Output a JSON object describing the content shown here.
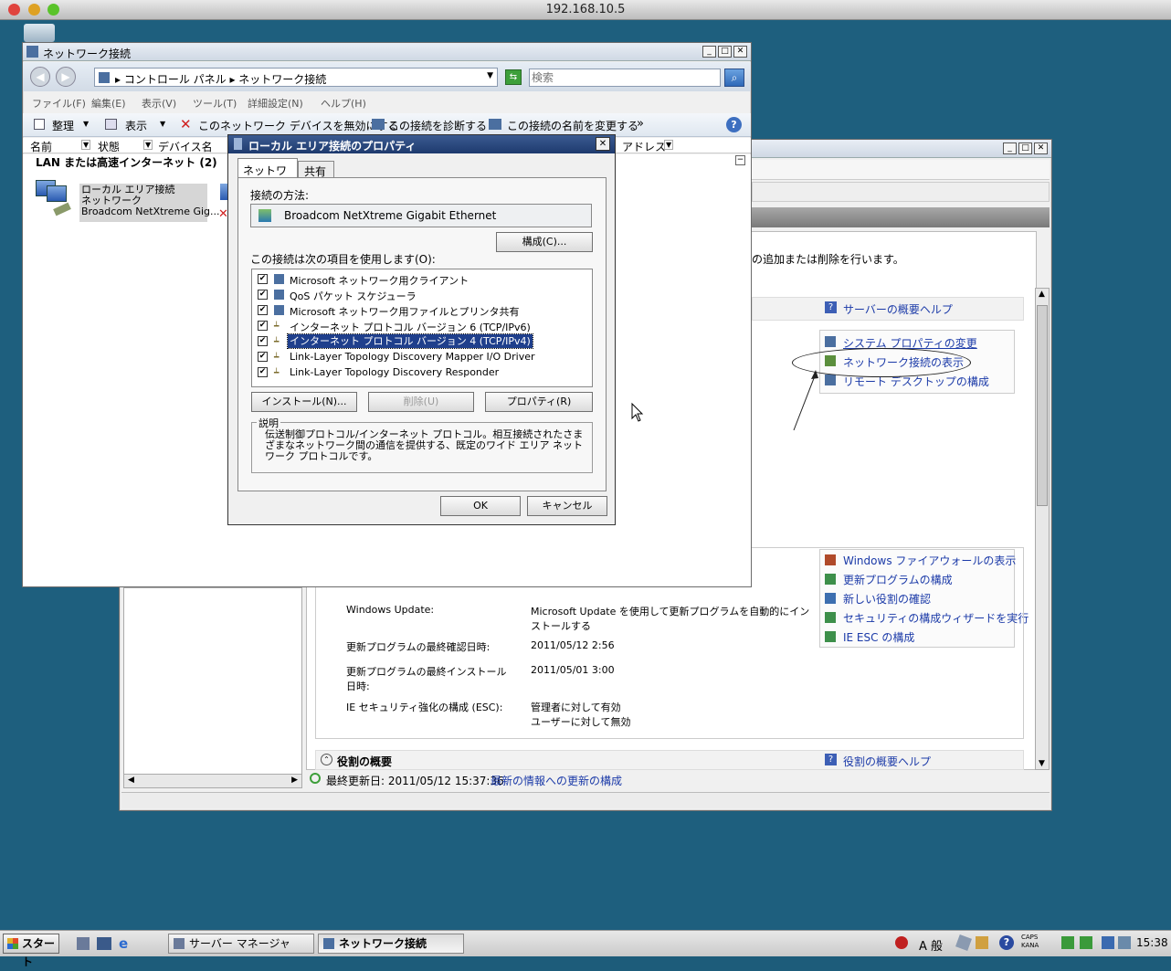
{
  "mac": {
    "title": "192.168.10.5"
  },
  "net_window": {
    "title": "ネットワーク接続",
    "breadcrumb": "▸ コントロール パネル ▸ ネットワーク接続",
    "search_placeholder": "検索",
    "menu": [
      "ファイル(F)",
      "編集(E)",
      "表示(V)",
      "ツール(T)",
      "詳細設定(N)",
      "ヘルプ(H)"
    ],
    "toolbar": {
      "organize": "整理",
      "view": "表示",
      "disable": "このネットワーク デバイスを無効にする",
      "diagnose": "この接続を診断する",
      "rename": "この接続の名前を変更する",
      "more": "»"
    },
    "columns": [
      "名前",
      "状態",
      "デバイス名",
      "アドレス"
    ],
    "group_header": "LAN または高速インターネット (2)",
    "item": {
      "name": "ローカル エリア接続",
      "type": "ネットワーク",
      "device": "Broadcom NetXtreme Gig..."
    }
  },
  "server_manager": {
    "desc_fragment": "の追加または削除を行います。",
    "help_link": "サーバーの概要ヘルプ",
    "links1": [
      "システム プロパティの変更",
      "ネットワーク接続の表示",
      "リモート デスクトップの構成"
    ],
    "links2": [
      "Windows ファイアウォールの表示",
      "更新プログラムの構成",
      "新しい役割の確認",
      "セキュリティの構成ウィザードを実行",
      "IE ESC の構成"
    ],
    "rows": [
      {
        "label": "Windows Update:",
        "value": "Microsoft Update を使用して更新プログラムを自動的にインストールする"
      },
      {
        "label": "更新プログラムの最終確認日時:",
        "value": "2011/05/12 2:56"
      },
      {
        "label": "更新プログラムの最終インストール日時:",
        "value": "2011/05/01 3:00"
      },
      {
        "label": "IE セキュリティ強化の構成 (ESC):",
        "value": "管理者に対して有効\nユーザーに対して無効"
      }
    ],
    "roles_header": "役割の概要",
    "roles_help": "役割の概要ヘルプ",
    "status_updated": "最終更新日: 2011/05/12 15:37:36",
    "status_link": "最新の情報への更新の構成"
  },
  "dialog": {
    "title": "ローカル エリア接続のプロパティ",
    "tabs": [
      "ネットワーク",
      "共有"
    ],
    "connect_using_label": "接続の方法:",
    "adapter": "Broadcom NetXtreme Gigabit Ethernet",
    "configure_btn": "構成(C)...",
    "items_label": "この接続は次の項目を使用します(O):",
    "items": [
      "Microsoft ネットワーク用クライアント",
      "QoS パケット スケジューラ",
      "Microsoft ネットワーク用ファイルとプリンタ共有",
      "インターネット プロトコル バージョン 6 (TCP/IPv6)",
      "インターネット プロトコル バージョン 4 (TCP/IPv4)",
      "Link-Layer Topology Discovery Mapper I/O Driver",
      "Link-Layer Topology Discovery Responder"
    ],
    "install_btn": "インストール(N)...",
    "uninstall_btn": "削除(U)",
    "properties_btn": "プロパティ(R)",
    "desc_label": "説明",
    "desc_text": "伝送制御プロトコル/インターネット プロトコル。相互接続されたさまざまなネットワーク間の通信を提供する、既定のワイド エリア ネットワーク プロトコルです。",
    "ok_btn": "OK",
    "cancel_btn": "キャンセル"
  },
  "taskbar": {
    "start": "スタート",
    "tasks": [
      "サーバー マネージャ",
      "ネットワーク接続"
    ],
    "ime": "A 般",
    "caps": "CAPS",
    "kana": "KANA",
    "clock": "15:38"
  }
}
